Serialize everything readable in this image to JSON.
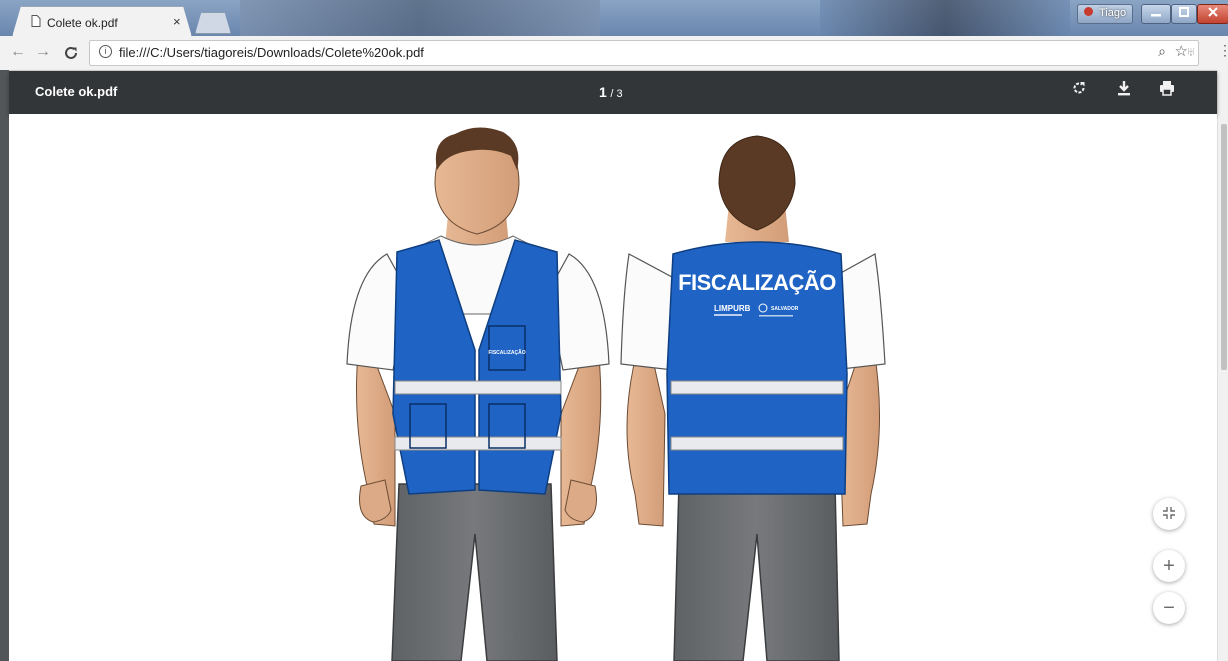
{
  "browser": {
    "tab_title": "Colete ok.pdf",
    "tab_close": "×",
    "profile_name": "Tiago",
    "url": "file:///C:/Users/tiagoreis/Downloads/Colete%20ok.pdf",
    "icons": [
      "back-icon",
      "forward-icon",
      "reload-icon",
      "info-icon",
      "zoom-icon",
      "star-icon",
      "extension-icon",
      "menu-icon"
    ]
  },
  "pdf": {
    "title": "Colete ok.pdf",
    "current_page": "1",
    "page_separator": "/",
    "total_pages": "3",
    "icons": [
      "rotate-icon",
      "download-icon",
      "print-icon"
    ],
    "page_content": {
      "front_pocket_text": "FISCALIZAÇÃO",
      "back_text": "FISCALIZAÇÃO",
      "logo_limpurb": "LIMPURB",
      "logo_salvador": "SALVADOR"
    },
    "controls": {
      "fit_icon": "fit-to-page-icon",
      "zoom_in": "+",
      "zoom_out": "−"
    }
  },
  "colors": {
    "vest_blue": "#1f63c4",
    "pants": "#6e7073",
    "toolbar_dark": "#323639"
  }
}
